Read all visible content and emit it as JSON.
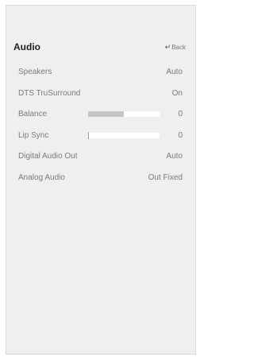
{
  "header": {
    "title": "Audio",
    "back_label": "Back",
    "back_icon": "↵"
  },
  "menu": {
    "items": [
      {
        "label": "Speakers",
        "value": "Auto"
      },
      {
        "label": "DTS TruSurround",
        "value": "On"
      },
      {
        "label": "Balance",
        "value": "0",
        "slider_fill": 0.5
      },
      {
        "label": "Lip Sync",
        "value": "0",
        "slider_marker": 0.0
      },
      {
        "label": "Digital Audio Out",
        "value": "Auto"
      },
      {
        "label": "Analog Audio",
        "value": "Out Fixed"
      }
    ]
  }
}
